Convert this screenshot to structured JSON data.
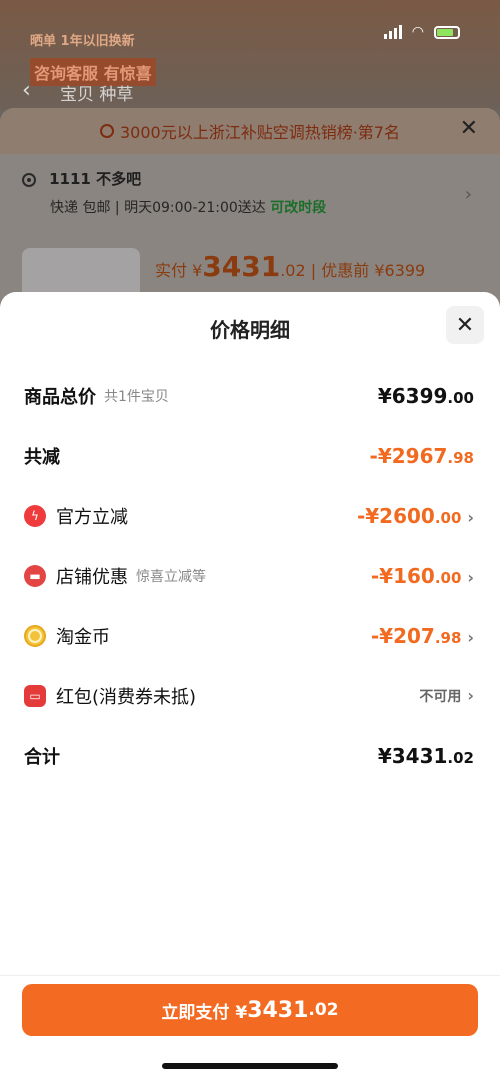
{
  "background": {
    "promo_line1": "晒单 1年以旧换新",
    "promo_line2": "咨询客服 有惊喜",
    "tab_label": "宝贝  种草",
    "rank_text": "3000元以上浙江补贴空调热销榜·第7名",
    "address_name": "1111 不多吧",
    "delivery_text": "快递 包邮 | 明天09:00-21:00送达",
    "delivery_change": "可改时段",
    "paid_label": "实付 ¥",
    "paid_amount": "3431",
    "paid_decimal": ".02",
    "before_discount": "| 优惠前 ¥6399"
  },
  "modal": {
    "title": "价格明细",
    "rows": [
      {
        "label": "商品总价",
        "sub": "共1件宝贝",
        "amount": "¥6399",
        "decimal": ".00"
      },
      {
        "label": "共减",
        "amount": "-¥2967",
        "decimal": ".98"
      },
      {
        "label": "官方立减",
        "amount": "-¥2600",
        "decimal": ".00"
      },
      {
        "label": "店铺优惠",
        "sub": "惊喜立减等",
        "amount": "-¥160",
        "decimal": ".00"
      },
      {
        "label": "淘金币",
        "amount": "-¥207",
        "decimal": ".98"
      },
      {
        "label": "红包(消费券未抵)",
        "status": "不可用"
      },
      {
        "label": "合计",
        "amount": "¥3431",
        "decimal": ".02"
      }
    ]
  },
  "pay_button": {
    "label": "立即支付 ¥",
    "amount": "3431",
    "decimal": ".02"
  },
  "colors": {
    "accent": "#f36b22",
    "discount": "#f26a20"
  }
}
